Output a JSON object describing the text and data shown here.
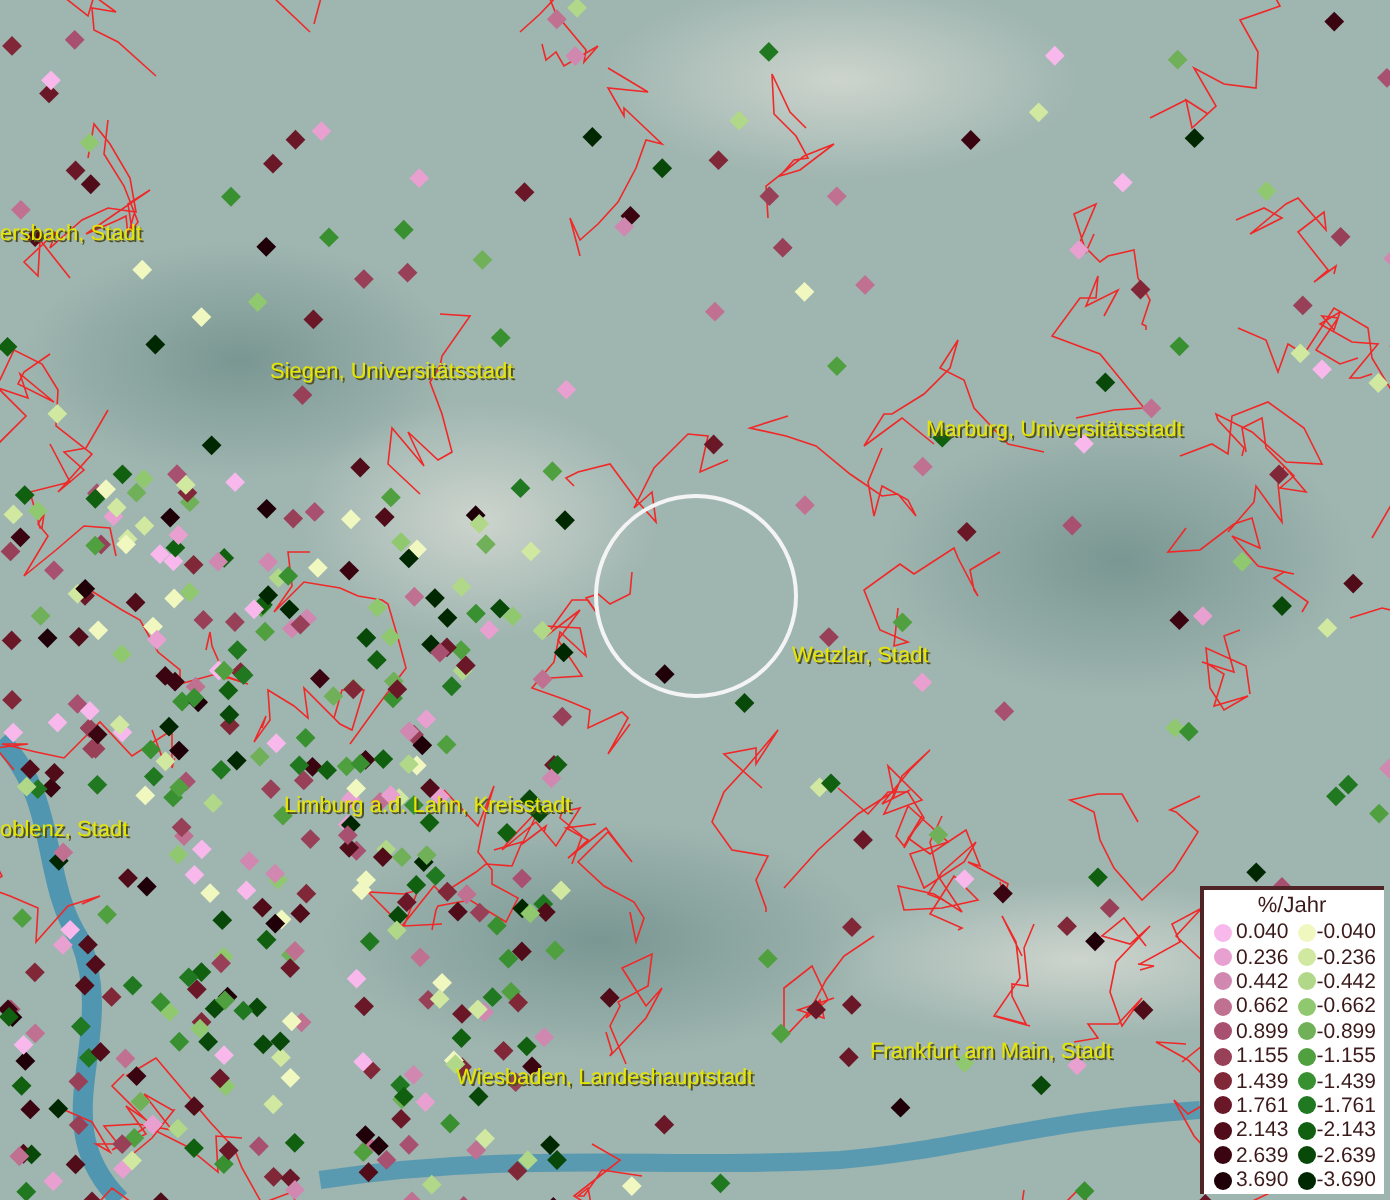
{
  "map": {
    "places": [
      {
        "name": "ersbach, Stadt"
      },
      {
        "name": "Siegen, Universitätsstadt"
      },
      {
        "name": "Marburg, Universitätsstadt"
      },
      {
        "name": "Wetzlar, Stadt"
      },
      {
        "name": "oblenz, Stadt"
      },
      {
        "name": "Limburg a.d. Lahn, Kreisstadt"
      },
      {
        "name": "Frankfurt am Main, Stadt"
      },
      {
        "name": "Wiesbaden, Landeshauptstadt"
      }
    ]
  },
  "legend": {
    "title": "%/Jahr",
    "rows": [
      {
        "positive": {
          "label": "0.040",
          "color": "#f8b8ec"
        },
        "negative": {
          "label": "-0.040",
          "color": "#f0f8c0"
        }
      },
      {
        "positive": {
          "label": "0.236",
          "color": "#e8a0d0"
        },
        "negative": {
          "label": "-0.236",
          "color": "#d0e8a0"
        }
      },
      {
        "positive": {
          "label": "0.442",
          "color": "#d088b0"
        },
        "negative": {
          "label": "-0.442",
          "color": "#b0d888"
        }
      },
      {
        "positive": {
          "label": "0.662",
          "color": "#c07090"
        },
        "negative": {
          "label": "-0.662",
          "color": "#90c870"
        }
      },
      {
        "positive": {
          "label": "0.899",
          "color": "#a85070"
        },
        "negative": {
          "label": "-0.899",
          "color": "#70b058"
        }
      },
      {
        "positive": {
          "label": "1.155",
          "color": "#984058"
        },
        "negative": {
          "label": "-1.155",
          "color": "#50a040"
        }
      },
      {
        "positive": {
          "label": "1.439",
          "color": "#802838"
        },
        "negative": {
          "label": "-1.439",
          "color": "#389030"
        }
      },
      {
        "positive": {
          "label": "1.761",
          "color": "#6a1828"
        },
        "negative": {
          "label": "-1.761",
          "color": "#207820"
        }
      },
      {
        "positive": {
          "label": "2.143",
          "color": "#500c18"
        },
        "negative": {
          "label": "-2.143",
          "color": "#106010"
        }
      },
      {
        "positive": {
          "label": "2.639",
          "color": "#3a0410"
        },
        "negative": {
          "label": "-2.639",
          "color": "#084808"
        }
      },
      {
        "positive": {
          "label": "3.690",
          "color": "#200008"
        },
        "negative": {
          "label": "-3.690",
          "color": "#002800"
        }
      }
    ]
  }
}
